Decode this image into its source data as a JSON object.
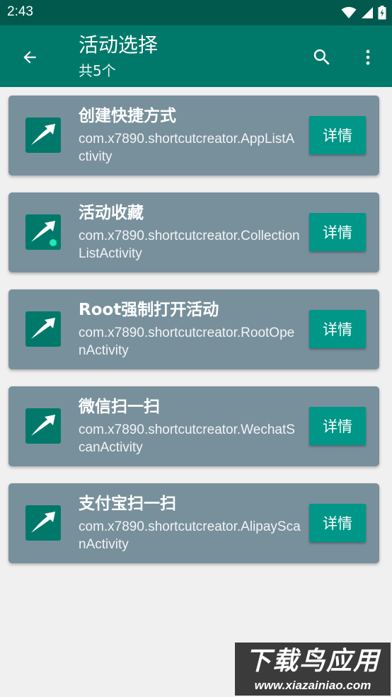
{
  "status_bar": {
    "time": "2:43"
  },
  "app_bar": {
    "title": "活动选择",
    "subtitle": "共5个"
  },
  "activities": [
    {
      "title": "创建快捷方式",
      "class_name": "com.x7890.shortcutcreator.AppListActivity",
      "detail_label": "详情"
    },
    {
      "title": "活动收藏",
      "class_name": "com.x7890.shortcutcreator.CollectionListActivity",
      "detail_label": "详情"
    },
    {
      "title": "Root强制打开活动",
      "class_name": "com.x7890.shortcutcreator.RootOpenActivity",
      "detail_label": "详情"
    },
    {
      "title": "微信扫一扫",
      "class_name": "com.x7890.shortcutcreator.WechatScanActivity",
      "detail_label": "详情"
    },
    {
      "title": "支付宝扫一扫",
      "class_name": "com.x7890.shortcutcreator.AlipayScanActivity",
      "detail_label": "详情"
    }
  ],
  "watermark": {
    "title": "下载鸟应用",
    "url": "www.xiazainiao.com"
  },
  "colors": {
    "primary_dark": "#00594c",
    "primary": "#00796b",
    "card": "#78909c",
    "button": "#009688"
  }
}
